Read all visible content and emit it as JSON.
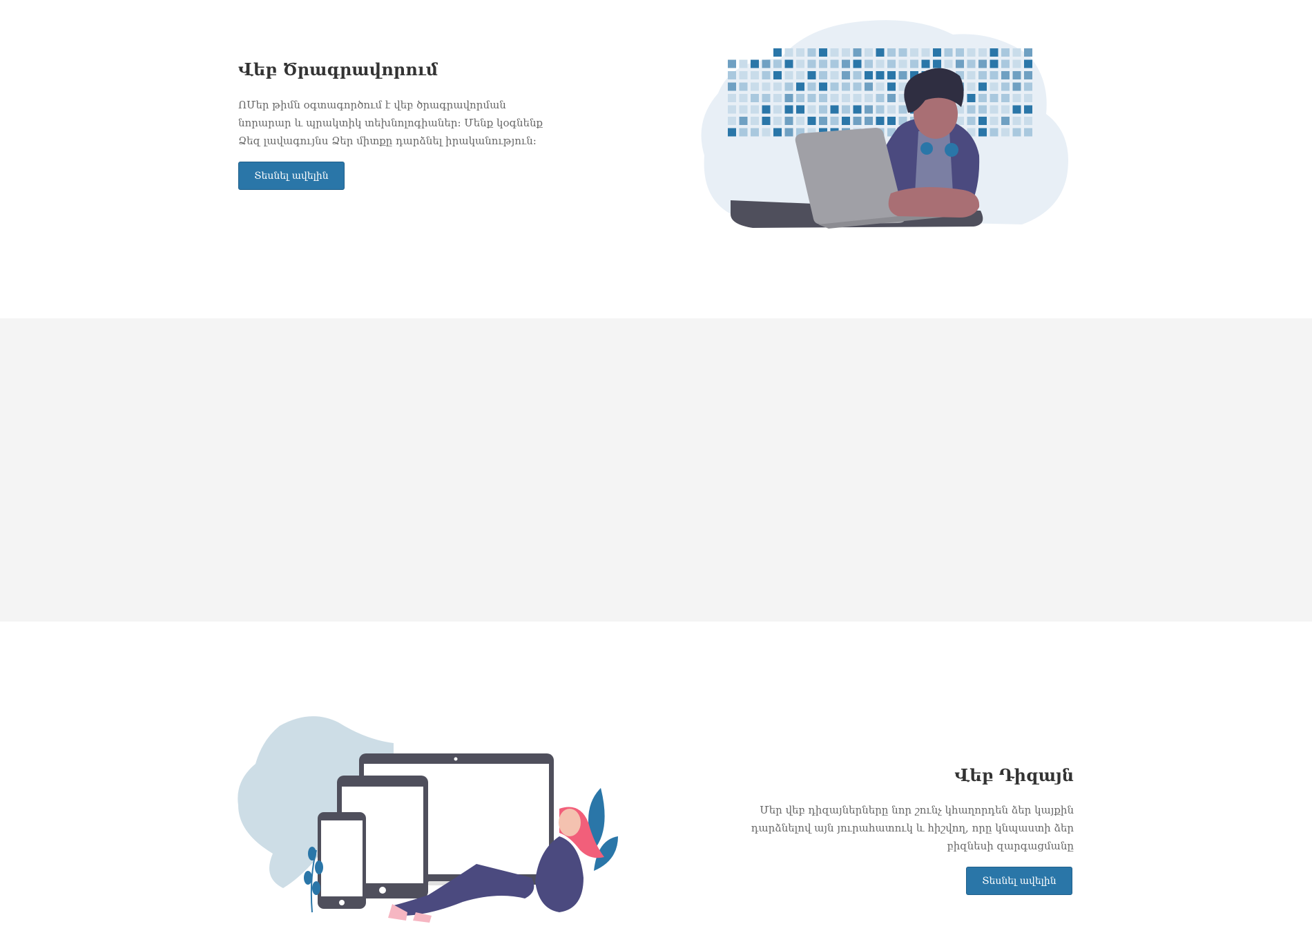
{
  "programming": {
    "title": "Վեբ Ծրագրավորում",
    "description": "ՈՄեր թիմն օգտագործում է վեբ ծրագրավորման նորարար և պրակտիկ տեխնոլոգիաներ: Մենք կօգնենք Ձեզ լավագույնս Ձեր միտքը դարձնել իրականություն:",
    "button_label": "Տեսնել ավելին"
  },
  "design": {
    "title": "Վեբ Դիզայն",
    "description": "Մեր վեբ դիզայներները նոր շունչ կհաղորդեն ձեր կայքին դարձնելով այն յուրահատուկ և հիշվող, որը կնպաստի ձեր բիզնեսի զարգացմանը",
    "button_label": "Տեսնել ավելին"
  },
  "colors": {
    "accent": "#2a76a8",
    "section_alt_bg": "#f4f4f4"
  }
}
